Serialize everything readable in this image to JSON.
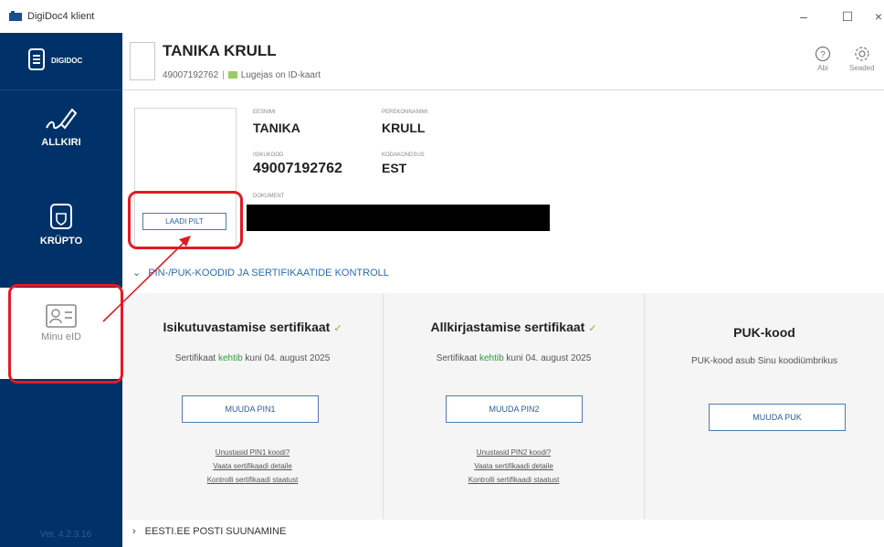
{
  "window": {
    "title": "DigiDoc4 klient",
    "min": "–",
    "max": "☐",
    "close": "×"
  },
  "sidebar": {
    "logo_text": "DIGIDOC",
    "items": [
      {
        "label": "ALLKIRI",
        "icon": "signature-icon"
      },
      {
        "label": "KRÜPTO",
        "icon": "shield-icon"
      },
      {
        "label": "Minu eID",
        "icon": "id-card-icon"
      }
    ],
    "version": "Ver. 4.2.3.16"
  },
  "header": {
    "name": "TANIKA KRULL",
    "id_code": "49007192762",
    "reader_text": "Lugejas on ID-kaart",
    "help_label": "Abi",
    "settings_label": "Seaded"
  },
  "person": {
    "first_name_label": "EESNIMI",
    "first_name": "TANIKA",
    "last_name_label": "PEREKONNANIMI",
    "last_name": "KRULL",
    "id_label": "ISIKUKOOD",
    "id_code": "49007192762",
    "citizenship_label": "KODAKONDSUS",
    "citizenship": "EST",
    "document_label": "DOKUMENT",
    "upload_button": "LAADI PILT"
  },
  "section": {
    "title": "PIN-/PUK-KOODID JA SERTIFIKAATIDE KONTROLL",
    "next": "EESTI.EE POSTI SUUNAMINE"
  },
  "cards": [
    {
      "title": "Isikutuvastamise sertifikaat",
      "status_prefix": "Sertifikaat",
      "status_word": "kehtib",
      "status_suffix": "kuni 04. august 2025",
      "button": "MUUDA PIN1",
      "links": [
        "Unustasid PIN1 koodi?",
        "Vaata sertifikaadi detaile",
        "Kontrolli sertifikaadi staatust"
      ]
    },
    {
      "title": "Allkirjastamise sertifikaat",
      "status_prefix": "Sertifikaat",
      "status_word": "kehtib",
      "status_suffix": "kuni 04. august 2025",
      "button": "MUUDA PIN2",
      "links": [
        "Unustasid PIN2 koodi?",
        "Vaata sertifikaadi detaile",
        "Kontrolli sertifikaadi staatust"
      ]
    },
    {
      "title": "PUK-kood",
      "status_prefix": "PUK-kood asub Sinu koodiümbrikus",
      "status_word": "",
      "status_suffix": "",
      "button": "MUUDA PUK",
      "links": []
    }
  ],
  "colors": {
    "sidebar": "#003168",
    "accent": "#2a6cb5",
    "highlight": "#e11b22",
    "valid": "#2e9a3e"
  }
}
